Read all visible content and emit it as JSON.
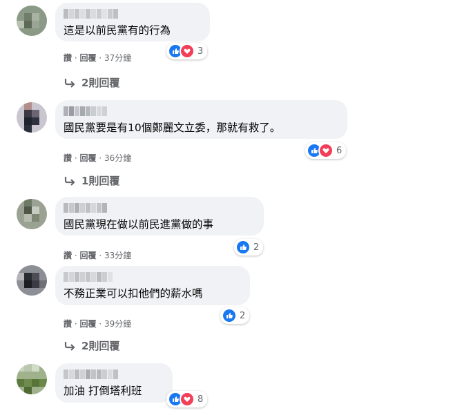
{
  "comments": [
    {
      "text": "這是以前民黨有的行為",
      "reactions": "3",
      "action_like": "讚",
      "action_reply": "回覆",
      "time": "37分鐘",
      "replies": "2則回覆"
    },
    {
      "text": "國民黨要是有10個鄭麗文立委，那就有救了。",
      "reactions": "6",
      "action_like": "讚",
      "action_reply": "回覆",
      "time": "36分鐘",
      "replies": "1則回覆"
    },
    {
      "text": "國民黨現在做以前民進黨做的事",
      "reactions": "2",
      "action_like": "讚",
      "action_reply": "回覆",
      "time": "33分鐘"
    },
    {
      "text": "不務正業可以扣他們的薪水嗎",
      "reactions": "2",
      "action_like": "讚",
      "action_reply": "回覆",
      "time": "39分鐘",
      "replies": "2則回覆"
    },
    {
      "text": "加油 打倒塔利班",
      "reactions": "8"
    }
  ],
  "separator": " · ",
  "colors": {
    "like": "#1877f2",
    "love": "#f33e58",
    "bubble": "#f0f2f5",
    "meta": "#65676b"
  },
  "icons": [
    "like-icon",
    "love-icon",
    "reply-arrow-icon"
  ]
}
